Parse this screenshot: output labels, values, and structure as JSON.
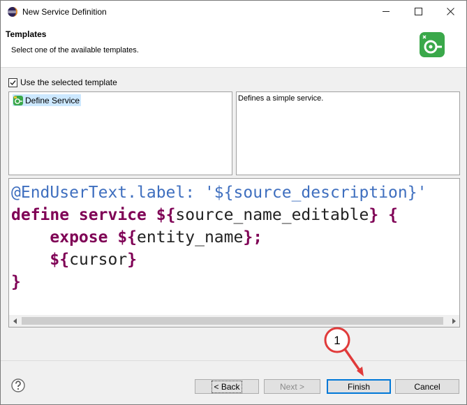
{
  "window": {
    "title": "New Service Definition",
    "controls": {
      "minimize": "minimize",
      "maximize": "maximize",
      "close": "close"
    }
  },
  "header": {
    "title": "Templates",
    "description": "Select one of the available templates."
  },
  "options": {
    "use_template_label": "Use the selected template",
    "use_template_checked": true
  },
  "templates": {
    "items": [
      {
        "label": "Define Service",
        "selected": true
      }
    ],
    "selected_description": "Defines a simple service."
  },
  "code_preview": {
    "lines": [
      "@EndUserText.label: '${source_description}'",
      "define service ${source_name_editable} {",
      "    expose ${entity_name};",
      "    ${cursor}",
      "}"
    ]
  },
  "buttons": {
    "back": "< Back",
    "next": "Next >",
    "finish": "Finish",
    "cancel": "Cancel"
  },
  "annotation": {
    "number": "1"
  },
  "colors": {
    "keyword": "#7f0055",
    "variable": "#2a00ff",
    "annotation": "#3f6fbf",
    "focus": "#0078d7",
    "callout": "#e03a3a"
  }
}
